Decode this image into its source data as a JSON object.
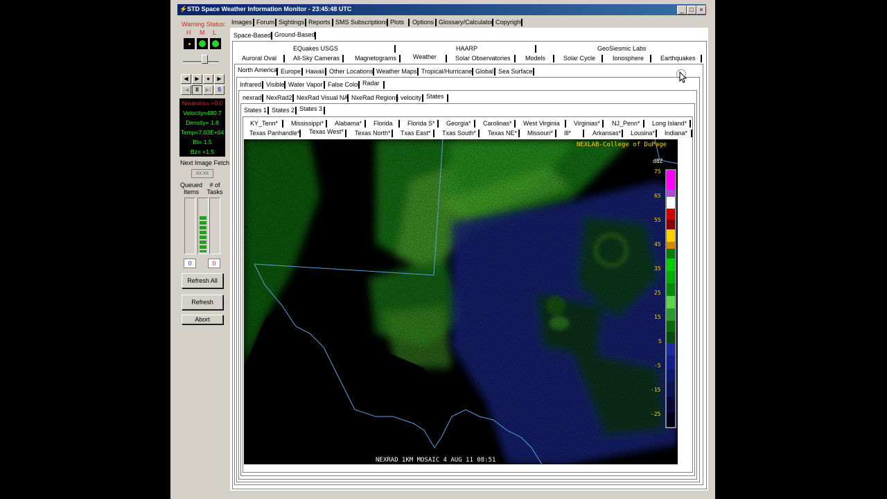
{
  "window": {
    "title": "STD Space Weather Information Monitor - 23:45:48 UTC",
    "min": "_",
    "max": "□",
    "close": "×"
  },
  "left": {
    "warning_title": "Warning Status:",
    "hml": [
      "H",
      "M",
      "L"
    ],
    "media_top": [
      "◀",
      "▶",
      "●",
      "▶"
    ],
    "media_bottom": [
      "|◀",
      "II",
      "▶|",
      "S"
    ],
    "readouts": [
      "Neutrons= +0.0",
      "Velocity=480.7",
      "Density= 1.8",
      "Temp=7.03E+04",
      "Bt= 1.5",
      "Bz= +1.5"
    ],
    "next_fetch_label": "Next Image Fetch",
    "next_fetch_value": "xx:xx",
    "queued_label": "Queued Items",
    "tasks_label": "# of Tasks",
    "queued_value": "0",
    "tasks_value": "0",
    "refresh_all": "Refresh All",
    "refresh": "Refresh",
    "abort": "Abort"
  },
  "menu": [
    "Images",
    "Forum",
    "Sightings",
    "Reports",
    "SMS Subscriptions",
    "Plots",
    "Options",
    "Glossary/Calculator",
    "Copyright"
  ],
  "sub1": [
    "Space-Based",
    "Ground-Based"
  ],
  "sub2_top": [
    "EQuakes USGS",
    "HAARP",
    "GeoSiesmic Labs"
  ],
  "sub2": [
    "Auroral Oval",
    "All-Sky Cameras",
    "Magnetograms",
    "Weather",
    "Solar Observatories",
    "Models",
    "Solar Cycle",
    "Ionosphere",
    "Earthquakes"
  ],
  "sub3": [
    "North America",
    "Europe",
    "Hawaii",
    "Other Locations",
    "Weather Maps",
    "Tropical/Hurricane",
    "Global",
    "Sea Surface"
  ],
  "sub4": [
    "Infrared",
    "Visible",
    "Water Vapor",
    "False Color",
    "Radar"
  ],
  "sub5": [
    "nexrad",
    "NexRad2",
    "NexRad Visual NA",
    "NxeRad Regions",
    "velocity",
    "States"
  ],
  "sub6": [
    "States 1",
    "States 2",
    "States 3"
  ],
  "states_row1": [
    "KY_Tenn*",
    "Mississippi*",
    "Alabama*",
    "Florida",
    "Florida S*",
    "Georgia*",
    "Carolinas*",
    "West Virginia",
    "Virginias*",
    "NJ_Penn*",
    "Long Island*"
  ],
  "states_row2": [
    "Texas Panhandle*",
    "Texas West*",
    "Texas North*",
    "Txas East*",
    "Txas South*",
    "Texas NE*",
    "Missouri*",
    "Ill*",
    "Arkansas*",
    "Lousina*",
    "Indiana*"
  ],
  "radar": {
    "credit": "NEXLAB-College of DuPage",
    "unit": "dBZ",
    "scale": [
      "75",
      "65",
      "55",
      "45",
      "35",
      "25",
      "15",
      "5",
      "-5",
      "-15",
      "-25"
    ],
    "caption": "NEXRAD 1KM MOSAIC 4 AUG 11  08:51",
    "colors": {
      "magenta": "#ff00ff",
      "red": "#d00000",
      "yellow": "#ffd000",
      "green": "#00d000",
      "blue": "#0000c0"
    }
  }
}
